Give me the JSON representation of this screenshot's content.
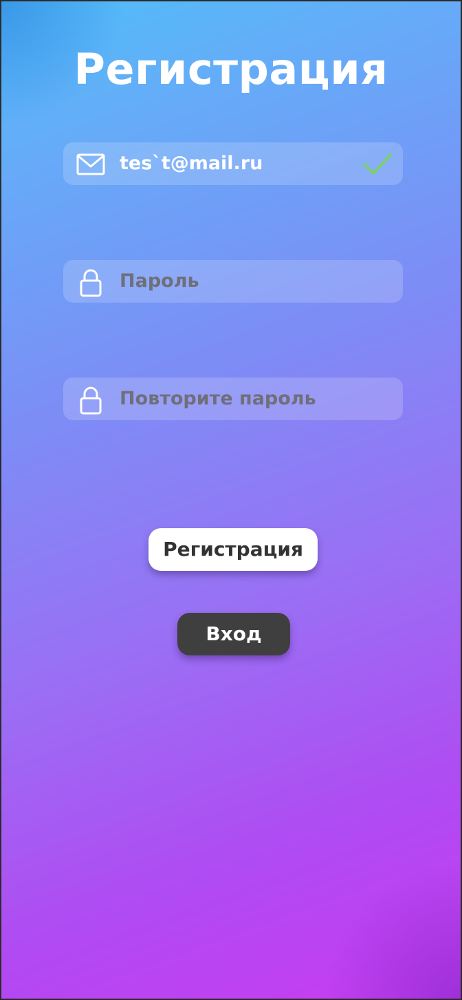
{
  "screen": {
    "title": "Регистрация"
  },
  "form": {
    "email": {
      "value": "tes`t@mail.ru",
      "icon": "mail-icon",
      "status_icon": "checkmark-icon",
      "status_color": "#7ccf6e"
    },
    "password": {
      "placeholder": "Пароль",
      "icon": "lock-icon"
    },
    "password_repeat": {
      "placeholder": "Повторите пароль",
      "icon": "lock-icon"
    }
  },
  "actions": {
    "register_label": "Регистрация",
    "login_label": "Вход"
  },
  "colors": {
    "gradient_top": "#4fbef7",
    "gradient_bottom": "#c83cf0",
    "register_button_bg": "#ffffff",
    "login_button_bg": "#3f3f3f"
  }
}
